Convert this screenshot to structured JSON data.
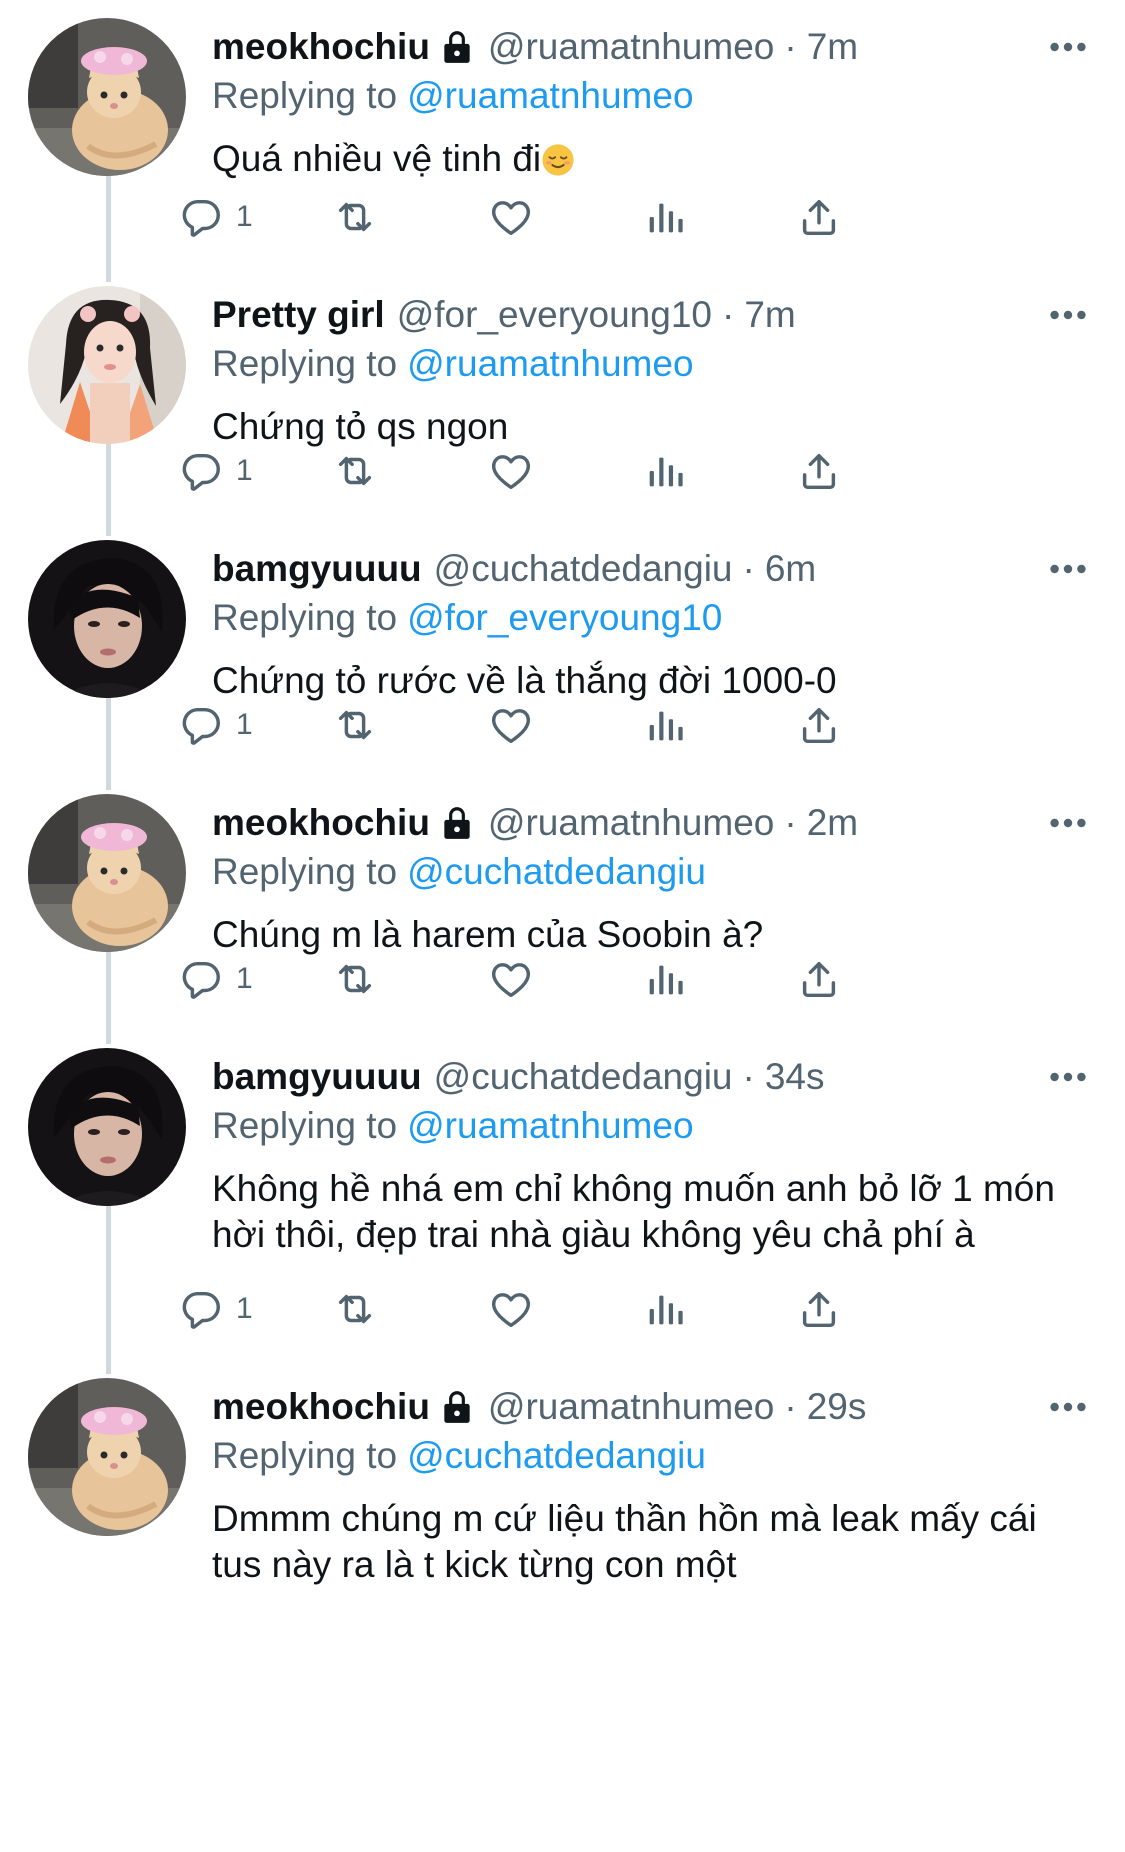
{
  "tweets": [
    {
      "name": "meokhochiu",
      "locked": true,
      "handle": "@ruamatnhumeo",
      "dot": "·",
      "time": "7m",
      "replying_label": "Replying to",
      "replying_to": "@ruamatnhumeo",
      "text": "Quá nhiều vệ tinh đi",
      "emoji": "relieved-face",
      "avatar": "cat-avatar",
      "reply_count": "1"
    },
    {
      "name": "Pretty girl",
      "locked": false,
      "handle": "@for_everyoung10",
      "dot": "·",
      "time": "7m",
      "replying_label": "Replying to",
      "replying_to": "@ruamatnhumeo",
      "text": "Chứng tỏ qs ngon",
      "avatar": "girl-avatar",
      "reply_count": "1"
    },
    {
      "name": "bamgyuuuu",
      "locked": false,
      "handle": "@cuchatdedangiu",
      "dot": "·",
      "time": "6m",
      "replying_label": "Replying to",
      "replying_to": "@for_everyoung10",
      "text": "Chứng tỏ rước về là thắng đời 1000-0",
      "avatar": "boy-avatar",
      "reply_count": "1"
    },
    {
      "name": "meokhochiu",
      "locked": true,
      "handle": "@ruamatnhumeo",
      "dot": "·",
      "time": "2m",
      "replying_label": "Replying to",
      "replying_to": "@cuchatdedangiu",
      "text": "Chúng m là harem của Soobin à?",
      "avatar": "cat-avatar",
      "reply_count": "1"
    },
    {
      "name": "bamgyuuuu",
      "locked": false,
      "handle": "@cuchatdedangiu",
      "dot": "·",
      "time": "34s",
      "replying_label": "Replying to",
      "replying_to": "@ruamatnhumeo",
      "text": "Không hề nhá em chỉ không muốn anh bỏ lỡ 1 món hời thôi, đẹp trai nhà giàu không yêu chả phí à",
      "avatar": "boy-avatar",
      "reply_count": "1"
    },
    {
      "name": "meokhochiu",
      "locked": true,
      "handle": "@ruamatnhumeo",
      "dot": "·",
      "time": "29s",
      "replying_label": "Replying to",
      "replying_to": "@cuchatdedangiu",
      "text": "Dmmm chúng m cứ liệu thần hồn mà leak mấy cái tus này ra là t kick từng con một",
      "avatar": "cat-avatar"
    }
  ],
  "icons": {
    "reply": "reply-icon",
    "retweet": "retweet-icon",
    "like": "like-icon",
    "views": "views-icon",
    "share": "share-icon",
    "more": "more-icon",
    "lock": "lock-icon"
  },
  "colors": {
    "link": "#1d9bf0",
    "secondary_text": "#536471",
    "primary_text": "#0f1419",
    "thread_line": "#cfd9de"
  }
}
